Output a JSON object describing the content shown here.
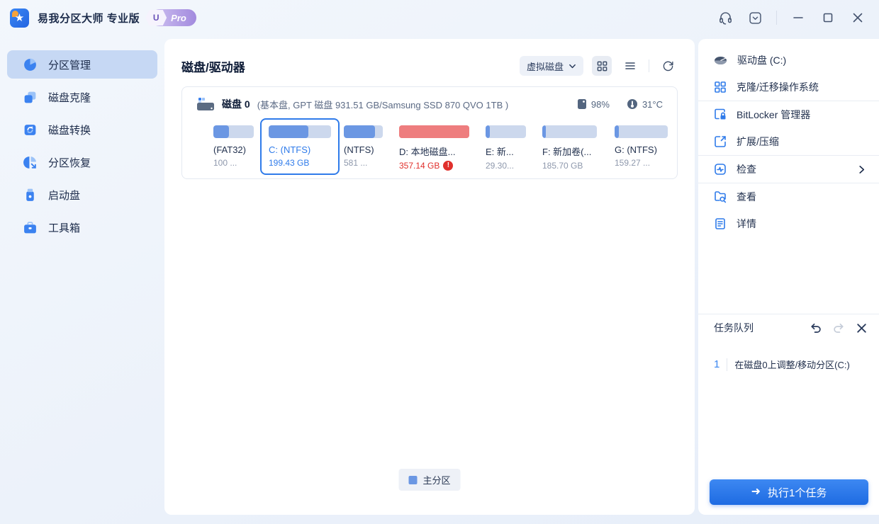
{
  "titlebar": {
    "app_title": "易我分区大师 专业版",
    "pro_badge": {
      "emblem": "U",
      "label": "Pro"
    },
    "icons": [
      "app-logo-star-icon",
      "headset-support-icon",
      "window-menu-icon",
      "minimize-icon",
      "maximize-icon",
      "close-icon"
    ]
  },
  "sidebar": {
    "items": [
      {
        "label": "分区管理",
        "icon": "partition-manage-pie-icon",
        "selected": true
      },
      {
        "label": "磁盘克隆",
        "icon": "disk-clone-icon",
        "selected": false
      },
      {
        "label": "磁盘转换",
        "icon": "disk-convert-icon",
        "selected": false
      },
      {
        "label": "分区恢复",
        "icon": "partition-recovery-icon",
        "selected": false
      },
      {
        "label": "启动盘",
        "icon": "boot-disk-usb-icon",
        "selected": false
      },
      {
        "label": "工具箱",
        "icon": "toolbox-icon",
        "selected": false
      }
    ]
  },
  "main": {
    "title": "磁盘/驱动器",
    "view_dropdown_label": "虚拟磁盘",
    "view_icons": [
      "grid-view-icon",
      "list-view-icon",
      "refresh-icon"
    ],
    "disk": {
      "name": "磁盘 0",
      "details": "(基本盘, GPT 磁盘 931.51 GB/Samsung SSD 870 QVO 1TB )",
      "health": "98%",
      "temperature": "31°C",
      "partitions": [
        {
          "name": "(FAT32)",
          "size": "100 ...",
          "fill": 39,
          "status": "normal"
        },
        {
          "name": "C: (NTFS)",
          "size": "199.43 GB",
          "fill": 64,
          "status": "selected"
        },
        {
          "name": "(NTFS)",
          "size": "581 ...",
          "fill": 80,
          "status": "normal"
        },
        {
          "name": "D: 本地磁盘...",
          "size": "357.14 GB",
          "fill": 100,
          "status": "warning"
        },
        {
          "name": "E: 新...",
          "size": "29.30...",
          "fill": 10,
          "status": "normal"
        },
        {
          "name": "F: 新加卷(...",
          "size": "185.70 GB",
          "fill": 7,
          "status": "normal"
        },
        {
          "name": "G: (NTFS)",
          "size": "159.27 ...",
          "fill": 8,
          "status": "normal"
        }
      ]
    },
    "legend_label": "主分区"
  },
  "right_panel": {
    "items": [
      {
        "label": "驱动盘  (C:)",
        "icon": "drive-disk-icon"
      },
      {
        "label": "克隆/迁移操作系统",
        "icon": "clone-migrate-os-icon"
      },
      {
        "label": "BitLocker 管理器",
        "icon": "bitlocker-lock-icon"
      },
      {
        "label": "扩展/压缩",
        "icon": "resize-expand-icon"
      },
      {
        "label": "检查",
        "icon": "check-health-icon"
      },
      {
        "label": "查看",
        "icon": "view-explore-icon"
      },
      {
        "label": "详情",
        "icon": "details-document-icon"
      }
    ],
    "task_queue": {
      "title": "任务队列",
      "icons": [
        "undo-icon",
        "redo-icon",
        "close-panel-icon"
      ],
      "tasks": [
        {
          "num": "1",
          "label": "在磁盘0上调整/移动分区(C:)"
        }
      ]
    },
    "execute_button_label": "执行1个任务"
  }
}
